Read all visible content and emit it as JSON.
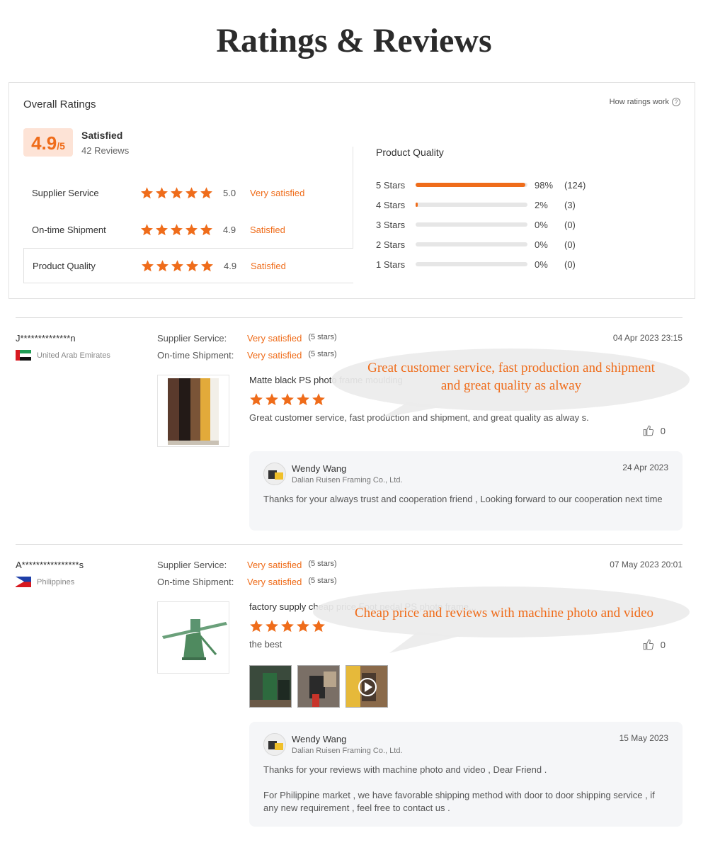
{
  "page_title": "Ratings & Reviews",
  "overall": {
    "heading": "Overall Ratings",
    "how_ratings_work": "How ratings work",
    "help_icon": "?",
    "score": "4.9",
    "score_max": "/5",
    "status": "Satisfied",
    "review_count": "42 Reviews",
    "categories": [
      {
        "label": "Supplier Service",
        "score": "5.0",
        "status": "Very satisfied",
        "stars": 5
      },
      {
        "label": "On-time Shipment",
        "score": "4.9",
        "status": "Satisfied",
        "stars": 5
      },
      {
        "label": "Product Quality",
        "score": "4.9",
        "status": "Satisfied",
        "stars": 5
      }
    ],
    "product_quality": {
      "title": "Product Quality",
      "rows": [
        {
          "label": "5  Stars",
          "percent": 98,
          "pct_text": "98%",
          "count": "(124)"
        },
        {
          "label": "4  Stars",
          "percent": 2,
          "pct_text": "2%",
          "count": "(3)"
        },
        {
          "label": "3  Stars",
          "percent": 0,
          "pct_text": "0%",
          "count": "(0)"
        },
        {
          "label": "2  Stars",
          "percent": 0,
          "pct_text": "0%",
          "count": "(0)"
        },
        {
          "label": "1  Stars",
          "percent": 0,
          "pct_text": "0%",
          "count": "(0)"
        }
      ]
    }
  },
  "reviews": [
    {
      "reviewer": "J**************n",
      "country": "United Arab Emirates",
      "date": "04 Apr 2023 23:15",
      "supplier_service_label": "Supplier Service:",
      "supplier_service_value": "Very satisfied",
      "supplier_service_stars": "(5 stars)",
      "shipment_label": "On-time Shipment:",
      "shipment_value": "Very satisfied",
      "shipment_stars": "(5 stars)",
      "product_name": "Matte black PS photo frame moulding",
      "rating": 5,
      "text": "Great customer service, fast production and shipment, and great quality as alway s.",
      "likes": "0",
      "reply": {
        "name": "Wendy Wang",
        "company": "Dalian Ruisen Framing Co., Ltd.",
        "date": "24 Apr 2023",
        "text": "Thanks for your always trust and cooperation friend , Looking forward to our cooperation next time"
      },
      "callout_line1": "Great customer service, fast production and shipment",
      "callout_line2": "and great quality as alway"
    },
    {
      "reviewer": "A****************s",
      "country": "Philippines",
      "date": "07 May 2023 20:01",
      "supplier_service_label": "Supplier Service:",
      "supplier_service_value": "Very satisfied",
      "supplier_service_stars": "(5 stars)",
      "shipment_label": "On-time Shipment:",
      "shipment_value": "Very satisfied",
      "shipment_stars": "(5 stars)",
      "product_name": "factory supply cheap price Foot pedal PS photo frame...",
      "rating": 5,
      "text": "the best",
      "likes": "0",
      "reply": {
        "name": "Wendy Wang",
        "company": "Dalian Ruisen Framing Co., Ltd.",
        "date": "15 May 2023",
        "text_1": "Thanks for your reviews with machine photo and video , Dear Friend .",
        "text_2": "For Philippine market , we have favorable shipping method with door to door shipping service , if any new requirement , feel free to contact us ."
      },
      "callout_line1": "Cheap price and reviews with machine photo and video"
    }
  ],
  "colors": {
    "accent": "#ef6c1a",
    "score_bg": "#fde3d6",
    "reply_bg": "#f5f6f8"
  }
}
